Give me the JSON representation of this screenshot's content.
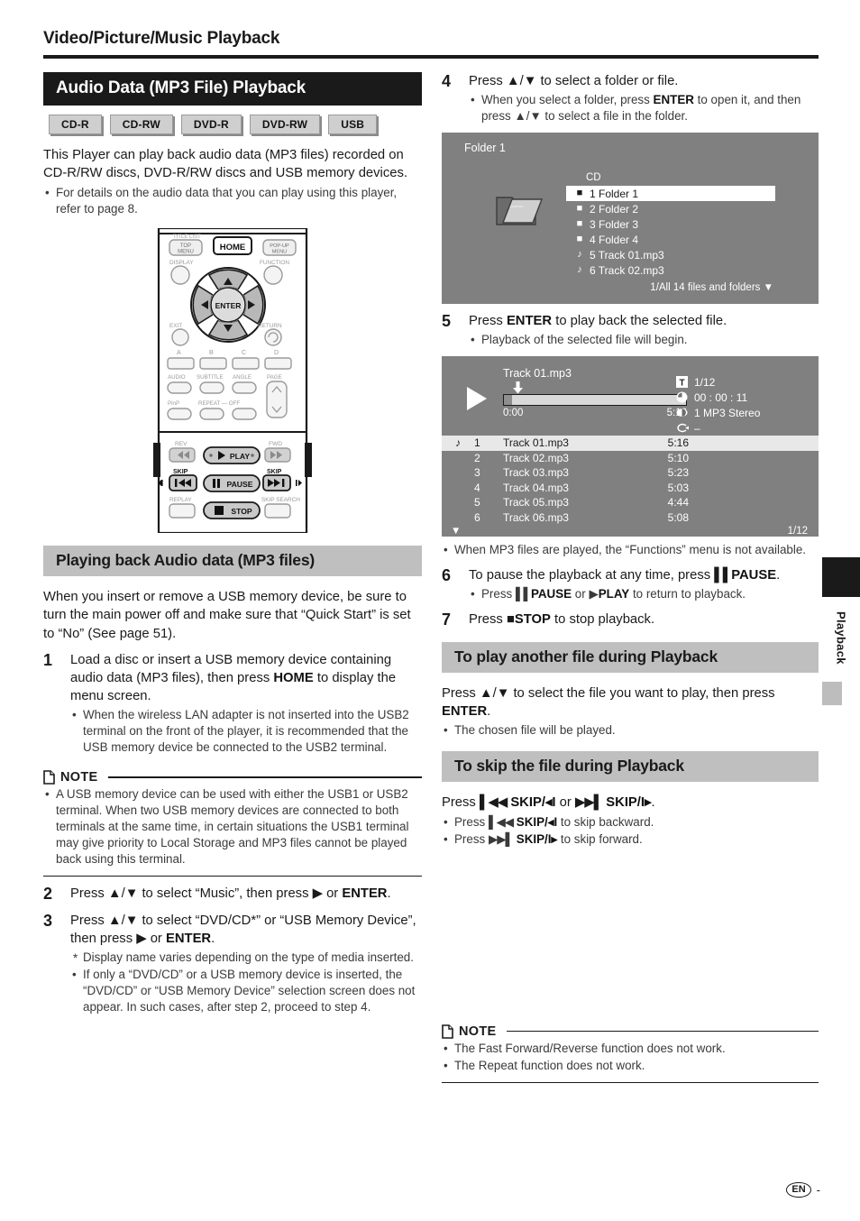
{
  "page": {
    "header_title": "Video/Picture/Music Playback",
    "footer_lang": "EN",
    "footer_dash": "-",
    "side_tab_label": "Playback"
  },
  "section_audio": {
    "title": "Audio Data (MP3 File) Playback",
    "badges": [
      "CD-R",
      "CD-RW",
      "DVD-R",
      "DVD-RW",
      "USB"
    ],
    "intro": "This Player can play back audio data (MP3 files) recorded on CD-R/RW discs, DVD-R/RW discs and USB memory devices.",
    "intro_bullets": [
      "For details on the audio data that you can play using this player, refer to page 8."
    ]
  },
  "remote": {
    "labels": {
      "title_list": "TITLE LIST",
      "top_menu_1": "TOP",
      "top_menu_2": "MENU",
      "home": "HOME",
      "popup_1": "POP-UP",
      "popup_2": "MENU",
      "display": "DISPLAY",
      "function": "FUNCTION",
      "enter": "ENTER",
      "exit": "EXIT",
      "return": "RETURN",
      "a": "A",
      "b": "B",
      "c": "C",
      "d": "D",
      "audio": "AUDIO",
      "subtitle": "SUBTITLE",
      "angle": "ANGLE",
      "page": "PAGE",
      "pinp": "PinP",
      "repeat": "REPEAT — OFF",
      "rev": "REV",
      "fwd": "FWD",
      "skip_l": "SKIP",
      "skip_r": "SKIP",
      "play": "PLAY",
      "pause": "PAUSE",
      "stop": "STOP",
      "replay": "REPLAY",
      "skip_search": "SKIP SEARCH"
    }
  },
  "section_playing_back": {
    "title": "Playing back Audio data (MP3 files)",
    "intro": "When you insert or remove a USB memory device, be sure to turn the main power off and make sure that “Quick Start” is set to “No” (See page 51).",
    "steps": [
      {
        "num": "1",
        "lead_a": "Load a disc or insert a USB memory device containing audio data (MP3 files), then press ",
        "lead_b": "HOME",
        "lead_c": " to display the menu screen.",
        "bullets": [
          "When the wireless LAN adapter is not inserted into the USB2 terminal on the front of the player, it is recommended that the USB memory device be connected to the USB2 terminal."
        ]
      },
      {
        "num": "2",
        "lead_a": "Press ▲/▼ to select “Music”, then press ▶ or ",
        "lead_b": "ENTER",
        "lead_c": ".",
        "bullets": []
      },
      {
        "num": "3",
        "lead_a": "Press ▲/▼ to select “DVD/CD*” or “USB Memory Device”, then press ▶ or ",
        "lead_b": "ENTER",
        "lead_c": ".",
        "bullets": []
      }
    ],
    "step3_star_bullet": "Display name varies depending on the type of media inserted.",
    "step3_bullet": "If only a “DVD/CD” or a USB memory device is inserted, the “DVD/CD” or “USB Memory Device” selection screen does not appear. In such cases, after step 2, proceed to step 4."
  },
  "note_left": {
    "label": "NOTE",
    "bullets": [
      "A USB memory device can be used with either the USB1 or USB2 terminal. When two USB memory devices are connected to both terminals at the same time, in certain situations the USB1 terminal may give priority to Local Storage and MP3 files cannot be played back using this terminal."
    ]
  },
  "steps_right": {
    "step4": {
      "num": "4",
      "lead": "Press ▲/▼ to select a folder or file.",
      "bullet_a": "When you select a folder, press ",
      "bullet_b": "ENTER",
      "bullet_c": " to open it, and then press ▲/▼ to select a file in the folder."
    },
    "step5": {
      "num": "5",
      "lead_a": "Press ",
      "lead_b": "ENTER",
      "lead_c": " to play back the selected file.",
      "bullets": [
        "Playback of the selected file will begin."
      ]
    },
    "after5_bullet": "When MP3 files are played, the “Functions” menu is not available.",
    "step6": {
      "num": "6",
      "lead_a": "To pause the playback at any time, press ",
      "lead_b": "PAUSE",
      "lead_c": ".",
      "bullet_a": "Press ",
      "bullet_b": "PAUSE",
      "bullet_c": " or ",
      "bullet_d": "PLAY",
      "bullet_e": " to return to playback."
    },
    "step7": {
      "num": "7",
      "lead_a": "Press ",
      "lead_b": "STOP",
      "lead_c": " to stop playback."
    }
  },
  "folder_screen": {
    "title": "Folder 1",
    "source_label": "CD",
    "rows": [
      {
        "icon": "folder-icon",
        "label": "1 Folder 1",
        "selected": true
      },
      {
        "icon": "folder-icon",
        "label": "2 Folder 2",
        "selected": false
      },
      {
        "icon": "folder-icon",
        "label": "3 Folder 3",
        "selected": false
      },
      {
        "icon": "folder-icon",
        "label": "4 Folder 4",
        "selected": false
      },
      {
        "icon": "music-note-icon",
        "label": "5 Track 01.mp3",
        "selected": false
      },
      {
        "icon": "music-note-icon",
        "label": "6 Track 02.mp3",
        "selected": false
      }
    ],
    "count_text": "1/All 14 files and folders"
  },
  "playback_screen": {
    "track_name": "Track 01.mp3",
    "time_start": "0:00",
    "time_end": "5:16",
    "info": [
      {
        "icon": "title-icon",
        "value": "1/12"
      },
      {
        "icon": "clock-icon",
        "value": "00 : 00 : 11"
      },
      {
        "icon": "audio-icon",
        "value": "1  MP3 Stereo"
      },
      {
        "icon": "repeat-icon",
        "value": "–"
      }
    ],
    "tracks": [
      {
        "no": "1",
        "name": "Track 01.mp3",
        "time": "5:16",
        "selected": true
      },
      {
        "no": "2",
        "name": "Track 02.mp3",
        "time": "5:10",
        "selected": false
      },
      {
        "no": "3",
        "name": "Track 03.mp3",
        "time": "5:23",
        "selected": false
      },
      {
        "no": "4",
        "name": "Track 04.mp3",
        "time": "5:03",
        "selected": false
      },
      {
        "no": "5",
        "name": "Track 05.mp3",
        "time": "4:44",
        "selected": false
      },
      {
        "no": "6",
        "name": "Track 06.mp3",
        "time": "5:08",
        "selected": false
      }
    ],
    "page_indicator": "1/12"
  },
  "section_play_another": {
    "title": "To play another file during Playback",
    "lead_a": "Press ▲/▼ to select the file you want to play, then press ",
    "lead_b": "ENTER",
    "lead_c": ".",
    "bullets": [
      "The chosen file will be played."
    ]
  },
  "section_skip": {
    "title": "To skip the file during Playback",
    "lead_a": "Press ",
    "lead_b": "SKIP/◂I",
    "lead_c": " or ",
    "lead_d": "SKIP/I▸",
    "lead_e": ".",
    "bullet1_a": "Press ",
    "bullet1_b": "SKIP/◂I",
    "bullet1_c": " to skip backward.",
    "bullet2_a": "Press ",
    "bullet2_b": "SKIP/I▸",
    "bullet2_c": " to skip forward."
  },
  "note_right": {
    "label": "NOTE",
    "bullets": [
      "The Fast Forward/Reverse function does not work.",
      "The Repeat function does not work."
    ]
  }
}
